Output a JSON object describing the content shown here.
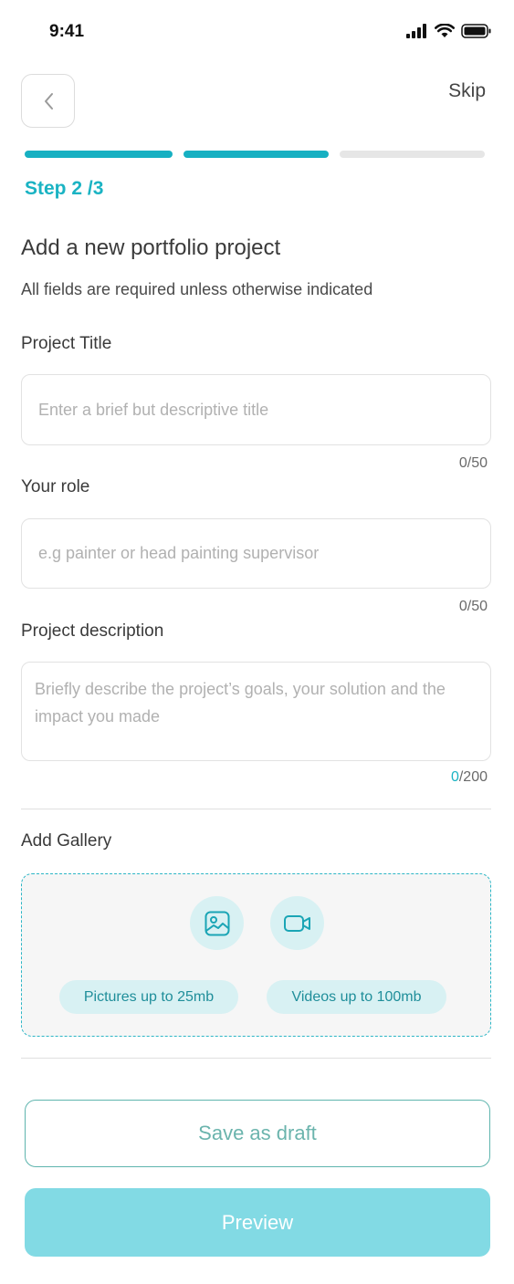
{
  "status_bar": {
    "time": "9:41"
  },
  "header": {
    "back_icon": "chevron-left-icon",
    "skip_label": "Skip"
  },
  "progress": {
    "step_label": "Step 2 /3",
    "current_step": 2,
    "total_steps": 3,
    "colors": {
      "active": "#17b0c2",
      "inactive": "#e6e6e6"
    }
  },
  "form": {
    "title": "Add a new portfolio project",
    "subtitle": "All fields are required unless otherwise indicated",
    "project_title": {
      "label": "Project Title",
      "value": "",
      "placeholder": "Enter a brief but descriptive title",
      "counter_current": "0",
      "counter_max": "/50"
    },
    "role": {
      "label": "Your role",
      "value": "",
      "placeholder": "e.g painter or head painting supervisor",
      "counter_current": "0",
      "counter_max": "/50"
    },
    "description": {
      "label": "Project description",
      "value": "",
      "placeholder": "Briefly describe the project’s goals, your solution and the impact you made",
      "counter_current": "0",
      "counter_max": "/200"
    }
  },
  "gallery": {
    "label": "Add Gallery",
    "picture_icon": "image-icon",
    "video_icon": "video-camera-icon",
    "pictures_chip": "Pictures up to 25mb",
    "videos_chip": "Videos up to 100mb"
  },
  "actions": {
    "save_draft_label": "Save as draft",
    "preview_label": "Preview"
  },
  "colors": {
    "accent": "#1ab3c3",
    "draft_border": "#5fb5ae",
    "preview_bg": "#82dae4"
  }
}
